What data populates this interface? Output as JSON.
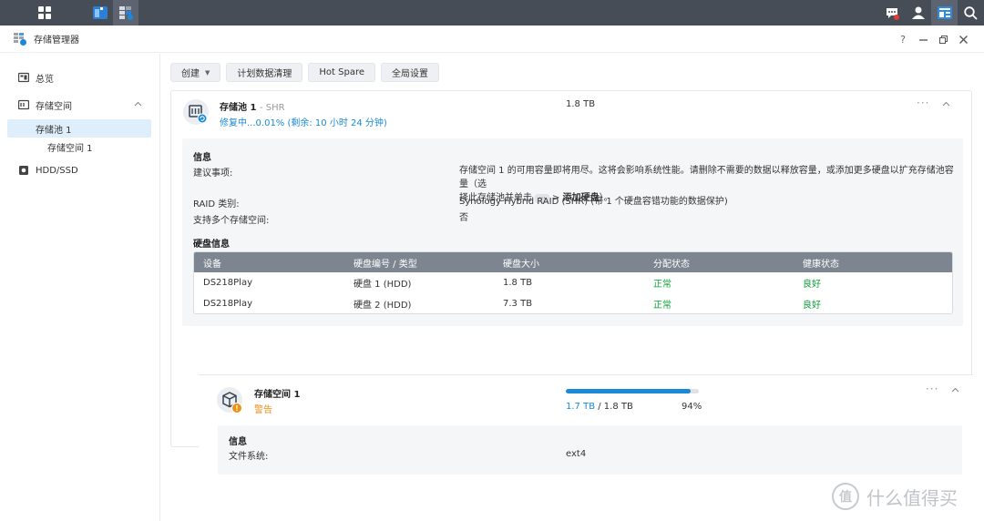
{
  "window": {
    "title": "存储管理器"
  },
  "sidebar": {
    "overview": "总览",
    "storage": "存储空间",
    "pool": "存储池 1",
    "volume": "存储空间 1",
    "hdd": "HDD/SSD"
  },
  "toolbar": {
    "create": "创建",
    "schedule": "计划数据清理",
    "hotspare": "Hot Spare",
    "global": "全局设置"
  },
  "pool": {
    "name": "存储池 1",
    "type": "- SHR",
    "status": "修复中...0.01% (剩余: 10 小时 24 分钟)",
    "size": "1.8 TB",
    "info": {
      "title": "信息",
      "suggest_label": "建议事项:",
      "suggest_value_1": "存储空间 1 的可用容量即将用尽。这将会影响系统性能。请删除不需要的数据以释放容量，或添加更多硬盘以扩充存储池容量（选",
      "suggest_value_2a": "择此存储池并单击",
      "suggest_chip": "···",
      "suggest_value_2b": "> ",
      "suggest_value_2c": "添加硬盘",
      "suggest_value_2d": "）。",
      "raid_label": "RAID 类别:",
      "raid_value": "Synology Hybrid RAID (SHR) (带 1 个硬盘容错功能的数据保护)",
      "multi_label": "支持多个存储空间:",
      "multi_value": "否"
    },
    "disk_title": "硬盘信息",
    "disk_headers": [
      "设备",
      "硬盘编号 / 类型",
      "硬盘大小",
      "分配状态",
      "健康状态"
    ],
    "disks": [
      {
        "device": "DS218Play",
        "slot": "硬盘 1 (HDD)",
        "size": "1.8 TB",
        "alloc": "正常",
        "health": "良好"
      },
      {
        "device": "DS218Play",
        "slot": "硬盘 2 (HDD)",
        "size": "7.3 TB",
        "alloc": "正常",
        "health": "良好"
      }
    ]
  },
  "volume": {
    "name": "存储空间 1",
    "status": "警告",
    "used": "1.7 TB",
    "total": " / 1.8 TB",
    "percent_label": "94%",
    "usage_fraction": 0.94,
    "info_title": "信息",
    "fs_label": "文件系统:",
    "fs_value": "ext4"
  },
  "watermark": {
    "text": "什么值得买",
    "logo": "值"
  },
  "colors": {
    "accent": "#1a89d6",
    "warning": "#e58b16",
    "ok": "#0ea33a",
    "taskbar": "#474d57"
  }
}
